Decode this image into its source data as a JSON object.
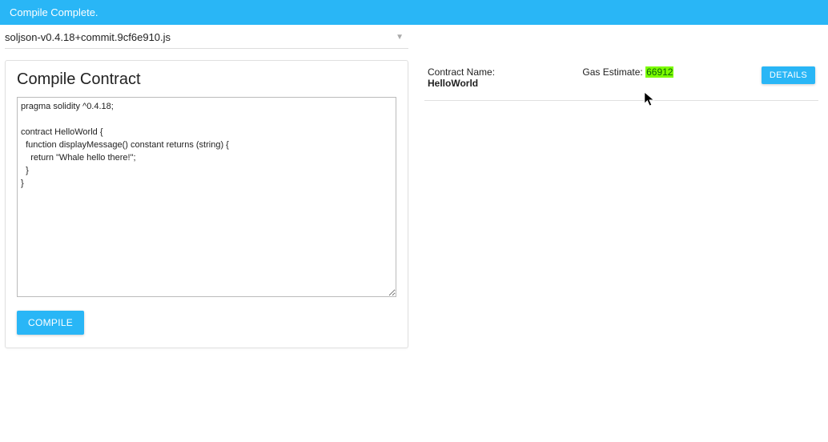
{
  "header": {
    "status": "Compile Complete."
  },
  "versionSelect": {
    "value": "soljson-v0.4.18+commit.9cf6e910.js"
  },
  "compile": {
    "title": "Compile Contract",
    "code": "pragma solidity ^0.4.18;\n\ncontract HelloWorld {\n  function displayMessage() constant returns (string) {\n    return \"Whale hello there!\";\n  }\n}",
    "button": "COMPILE"
  },
  "result": {
    "contractNameLabel": "Contract Name:",
    "contractNameValue": "HelloWorld",
    "gasLabel": "Gas Estimate: ",
    "gasValue": "66912",
    "detailsButton": "DETAILS"
  }
}
